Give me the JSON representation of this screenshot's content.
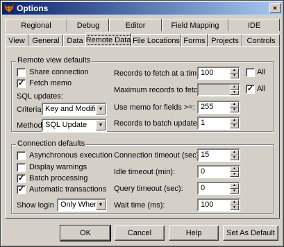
{
  "window": {
    "title": "Options",
    "close_glyph": "×"
  },
  "tabs_row1": [
    {
      "label": "Regional"
    },
    {
      "label": "Debug"
    },
    {
      "label": "Editor"
    },
    {
      "label": "Field Mapping"
    },
    {
      "label": "IDE"
    }
  ],
  "tabs_row2": [
    {
      "label": "View"
    },
    {
      "label": "General"
    },
    {
      "label": "Data"
    },
    {
      "label": "Remote Data"
    },
    {
      "label": "File Locations"
    },
    {
      "label": "Forms"
    },
    {
      "label": "Projects"
    },
    {
      "label": "Controls"
    }
  ],
  "remote_view": {
    "legend": "Remote view defaults",
    "share_connection": {
      "label": "Share connection",
      "checked": false,
      "mark": ""
    },
    "fetch_memo": {
      "label": "Fetch memo",
      "checked": true,
      "mark": "✓"
    },
    "sql_updates_label": "SQL updates:",
    "criteria": {
      "label": "Criteria",
      "value": "Key and Modified F"
    },
    "method": {
      "label": "Method",
      "value": "SQL Update"
    },
    "records_to_fetch": {
      "label": "Records to fetch at a time:",
      "value": "100",
      "all_label": "All",
      "all_checked": false,
      "all_mark": ""
    },
    "max_records": {
      "label": "Maximum records to fetch:",
      "value": "",
      "all_label": "All",
      "all_checked": true,
      "all_mark": "✓"
    },
    "use_memo": {
      "label": "Use memo for fields >=:",
      "value": "255"
    },
    "batch_update": {
      "label": "Records to batch update:",
      "value": "1"
    }
  },
  "connection": {
    "legend": "Connection defaults",
    "async": {
      "label": "Asynchronous execution",
      "checked": false,
      "mark": ""
    },
    "warnings": {
      "label": "Display warnings",
      "checked": false,
      "mark": ""
    },
    "batch": {
      "label": "Batch processing",
      "checked": true,
      "mark": "✓"
    },
    "auto_tx": {
      "label": "Automatic transactions",
      "checked": true,
      "mark": "✓"
    },
    "show_login": {
      "label": "Show login",
      "value": "Only When N"
    },
    "conn_timeout": {
      "label": "Connection timeout (sec):",
      "value": "15"
    },
    "idle_timeout": {
      "label": "Idle timeout (min):",
      "value": "0"
    },
    "query_timeout": {
      "label": "Query timeout (sec):",
      "value": "0"
    },
    "wait_time": {
      "label": "Wait time (ms):",
      "value": "100"
    }
  },
  "buttons": {
    "ok": "OK",
    "cancel": "Cancel",
    "help": "Help",
    "set_default": "Set As Default"
  },
  "icons": {
    "spin_up": "▲",
    "spin_down": "▼",
    "dropdown": "▼"
  },
  "colors": {
    "title_start": "#0a246a",
    "title_end": "#a6caf0",
    "face": "#d4d0c8"
  }
}
